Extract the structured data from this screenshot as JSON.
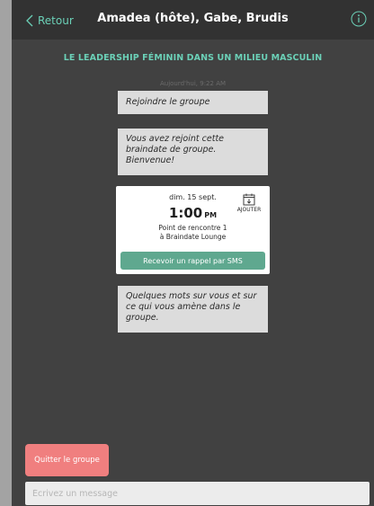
{
  "topbar": {
    "back_label": "Retour",
    "title": "Amadea (hôte), Gabe, Brudis"
  },
  "chat": {
    "group_name": "LE LEADERSHIP FÉMININ DANS UN MILIEU MASCULIN",
    "timestamp": "Aujourd'hui, 9:22 AM",
    "messages": [
      "Rejoindre le groupe",
      "Vous avez rejoint cette braindate de groupe. Bienvenue!",
      "Quelques mots sur vous et sur ce qui vous amène dans le groupe."
    ]
  },
  "meeting_card": {
    "date": "dim. 15 sept.",
    "time": "1:00",
    "ampm": "PM",
    "location_line1": "Point de rencontre 1",
    "location_line2": "à Braindate Lounge",
    "add_label": "AJOUTER",
    "sms_button": "Recevoir un rappel par SMS"
  },
  "footer": {
    "quit_button": "Quitter le groupe",
    "message_placeholder": "Écrivez un message"
  },
  "colors": {
    "accent": "#6bd0b7",
    "sms_button": "#5fa88f",
    "quit_button": "#f07f7f",
    "background": "#414141",
    "topbar": "#323232"
  }
}
